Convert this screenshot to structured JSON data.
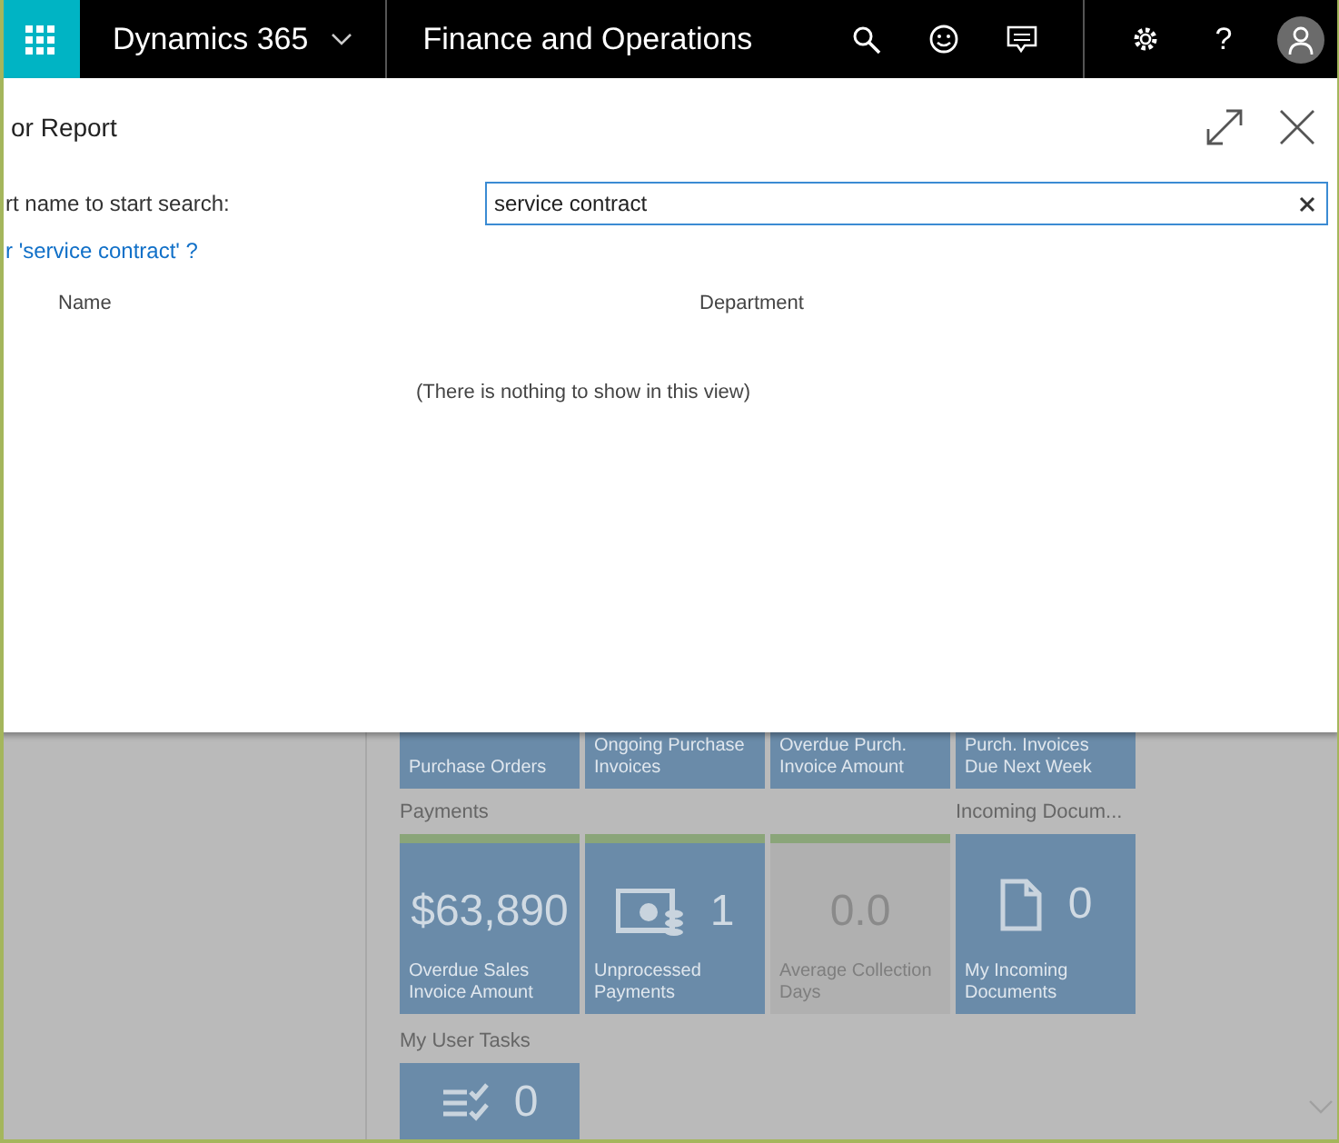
{
  "top_bar": {
    "product": "Dynamics 365",
    "module": "Finance and Operations",
    "help": "?"
  },
  "dialog": {
    "title": "or Report",
    "search_label": "rt name to start search:",
    "search": {
      "value": "service contract"
    },
    "suggestion": "r 'service contract' ?",
    "columns": [
      "Name",
      "Department"
    ],
    "empty_message": "(There is nothing to show in this view)"
  },
  "workspace": {
    "rows": [
      {
        "sections": [
          {
            "tiles": [
              {
                "label": "Purchase Orders",
                "color": "#6a8ba9"
              },
              {
                "label": "Ongoing Purchase Invoices",
                "color": "#6a8ba9"
              },
              {
                "label": "Overdue Purch. Invoice Amount",
                "color": "#6a8ba9"
              },
              {
                "label": "Purch. Invoices Due Next Week",
                "color": "#6a8ba9"
              }
            ]
          }
        ]
      },
      {
        "sections": [
          {
            "heading": "Payments",
            "tiles": [
              {
                "kind": "amount",
                "value": "$63,890",
                "label": "Overdue Sales Invoice Amount",
                "color": "#6a8ba9",
                "flagged": true
              },
              {
                "kind": "payment",
                "value": "1",
                "label": "Unprocessed Payments",
                "color": "#6a8ba9",
                "flagged": true
              },
              {
                "kind": "amount",
                "value": "0.0",
                "label": "Average Collection Days",
                "color": "#b0b0b0",
                "flagged": true
              }
            ]
          },
          {
            "heading": "Incoming Docum...",
            "tiles": [
              {
                "kind": "document",
                "value": "0",
                "label": "My Incoming Documents",
                "color": "#6a8ba9",
                "flagged": false
              }
            ]
          }
        ]
      },
      {
        "sections": [
          {
            "heading": "My User Tasks",
            "tiles": [
              {
                "kind": "tasks",
                "value": "0",
                "color": "#6a8ba9",
                "flagged": false
              }
            ]
          }
        ]
      }
    ]
  }
}
